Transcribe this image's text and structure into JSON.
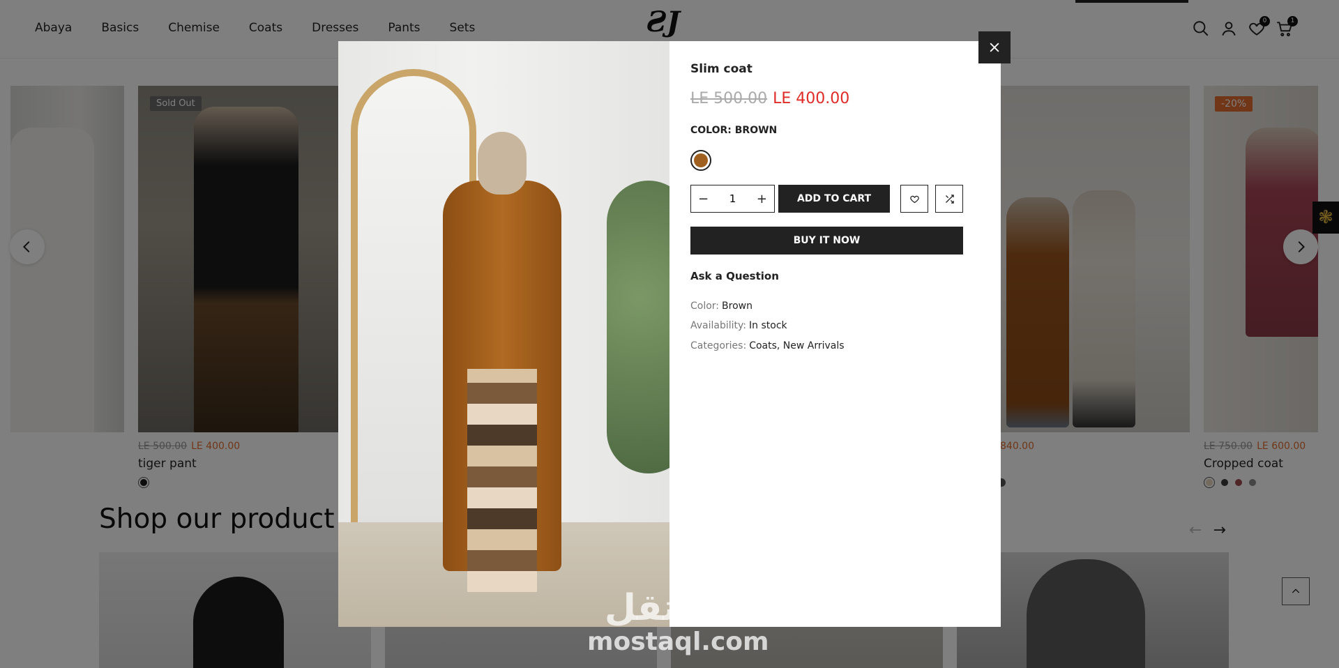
{
  "header": {
    "nav": [
      "Abaya",
      "Basics",
      "Chemise",
      "Coats",
      "Dresses",
      "Pants",
      "Sets"
    ],
    "logo": "ƧJ",
    "wishlist_count": "0",
    "cart_count": "1",
    "icons": [
      "search-icon",
      "user-icon",
      "heart-icon",
      "cart-icon"
    ]
  },
  "carousel": {
    "sold_out_label": "Sold Out",
    "discount_label": "-20%",
    "cards": [
      {
        "old_price": "LE 500.00",
        "new_price": "LE 400.00",
        "title": "tiger pant"
      },
      {
        "old_price": "",
        "new_price": "840.00",
        "title": ""
      },
      {
        "old_price": "LE 750.00",
        "new_price": "LE 600.00",
        "title": "Cropped coat"
      }
    ],
    "swatch_colors": [
      "#e8d6bd",
      "#3a3a3a",
      "#a04a4a",
      "#8a8a8a"
    ]
  },
  "section": {
    "title": "Shop our product"
  },
  "quickview": {
    "title": "Slim coat",
    "old_price": "LE 500.00",
    "new_price": "LE 400.00",
    "color_label": "COLOR: BROWN",
    "swatch_color": "#a0601f",
    "quantity": "1",
    "add_to_cart": "ADD TO CART",
    "buy_now": "BUY IT NOW",
    "ask_question": "Ask a Question",
    "meta": [
      {
        "key": "Color:",
        "value": "Brown"
      },
      {
        "key": "Availability:",
        "value": "In stock"
      },
      {
        "key": "Categories:",
        "value": "Coats, New Arrivals"
      }
    ]
  },
  "watermark": {
    "arabic": "مستقل",
    "latin": "mostaql.com"
  },
  "colors": {
    "accent_orange": "#e06d2e",
    "sale_red": "#e02b27",
    "dark": "#222222"
  }
}
